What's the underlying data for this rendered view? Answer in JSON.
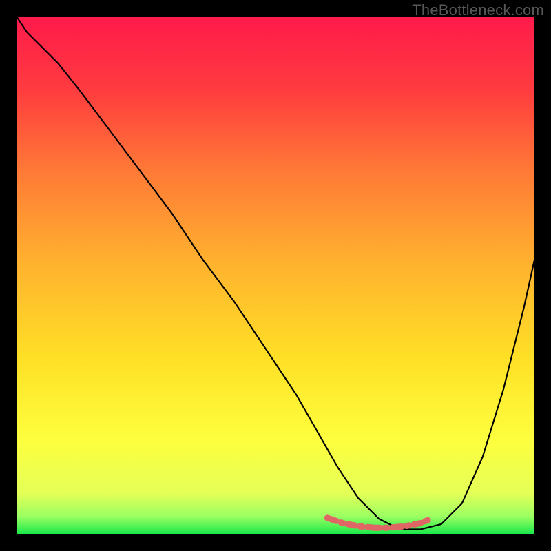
{
  "watermark": "TheBottleneck.com",
  "chart_data": {
    "type": "line",
    "title": "",
    "xlabel": "",
    "ylabel": "",
    "xlim": [
      0,
      100
    ],
    "ylim": [
      0,
      100
    ],
    "gradient_stops": [
      {
        "offset": 0,
        "color": "#ff1a4b"
      },
      {
        "offset": 0.14,
        "color": "#ff3b3f"
      },
      {
        "offset": 0.3,
        "color": "#ff7a36"
      },
      {
        "offset": 0.48,
        "color": "#ffb32e"
      },
      {
        "offset": 0.66,
        "color": "#ffe026"
      },
      {
        "offset": 0.82,
        "color": "#fdff3e"
      },
      {
        "offset": 0.92,
        "color": "#e4ff57"
      },
      {
        "offset": 0.965,
        "color": "#9bff62"
      },
      {
        "offset": 1.0,
        "color": "#17e84a"
      }
    ],
    "series": [
      {
        "name": "bottleneck-curve",
        "x": [
          0,
          2,
          4,
          8,
          12,
          18,
          24,
          30,
          36,
          42,
          48,
          54,
          58,
          62,
          66,
          70,
          74,
          78,
          82,
          86,
          90,
          94,
          98,
          100
        ],
        "y": [
          100,
          97,
          95,
          91,
          86,
          78,
          70,
          62,
          53,
          45,
          36,
          27,
          20,
          13,
          7,
          3,
          1,
          1,
          2,
          6,
          15,
          28,
          44,
          53
        ]
      }
    ],
    "highlight_segment": {
      "name": "optimal-range",
      "color": "#e06666",
      "x": [
        60,
        63,
        66,
        69,
        72,
        75,
        78,
        80
      ],
      "y": [
        3.2,
        2.2,
        1.6,
        1.3,
        1.3,
        1.6,
        2.2,
        3.0
      ]
    }
  }
}
